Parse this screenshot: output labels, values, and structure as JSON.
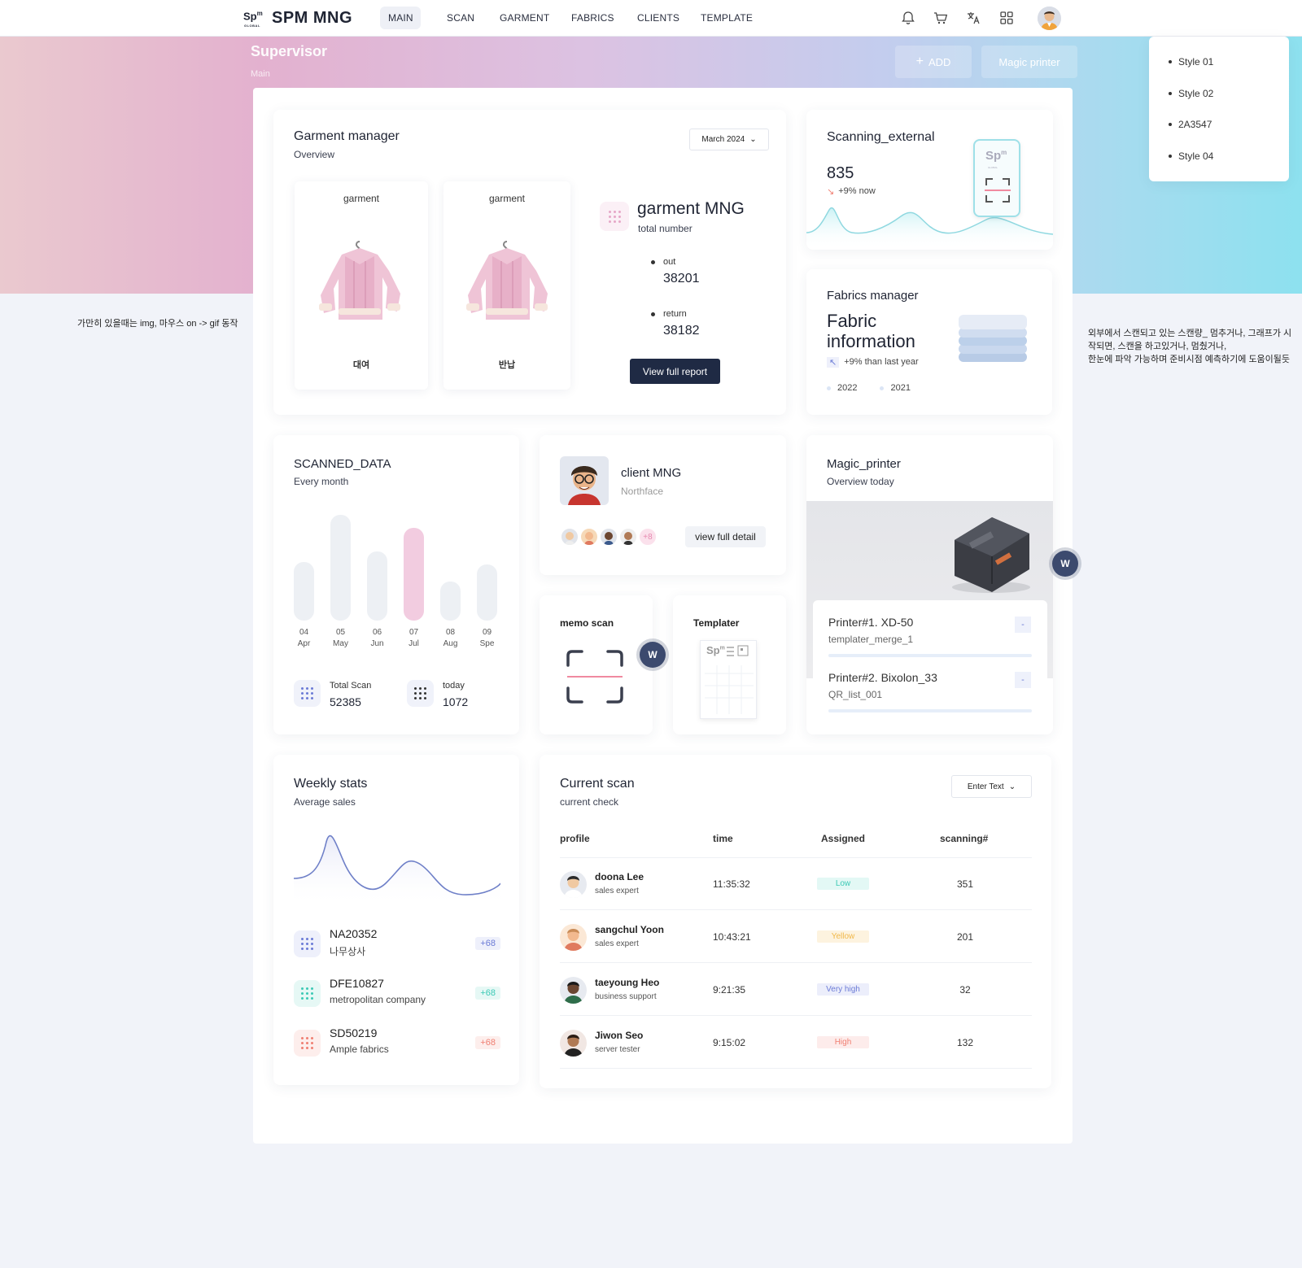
{
  "brand": {
    "mark": "Sp",
    "mark_sup": "m",
    "mark_small": "GLOBAL",
    "name": "SPM MNG"
  },
  "nav": {
    "items": [
      "MAIN",
      "SCAN",
      "GARMENT",
      "FABRICS",
      "CLIENTS",
      "TEMPLATE"
    ],
    "active": "MAIN"
  },
  "toolbar_icons": [
    "bell-icon",
    "cart-icon",
    "translate-icon",
    "apps-grid-icon"
  ],
  "hero": {
    "title": "Supervisor",
    "breadcrumb": "Main",
    "add_label": "ADD",
    "magic_label": "Magic printer"
  },
  "style_menu": [
    "Style 01",
    "Style 02",
    "2A3547",
    "Style 04"
  ],
  "notes": {
    "left": "가만히 있을때는 img, 마우스 on -> gif 동작",
    "right": [
      "외부에서 스캔되고 있는 스캔량_ 멈추거나, 그래프가 시",
      "작되면, 스캔을 하고있거나, 멈췄거나,",
      "한눈에 파악 가능하며 준비시점 예측하기에 도움이될듯"
    ]
  },
  "garment_manager": {
    "title": "Garment manager",
    "subtitle": "Overview",
    "month": "March 2024",
    "cards": [
      {
        "top": "garment",
        "bottom": "대여"
      },
      {
        "top": "garment",
        "bottom": "반납"
      }
    ],
    "mng_title": "garment MNG",
    "mng_sub": "total number",
    "out_label": "out",
    "out_value": "38201",
    "return_label": "return",
    "return_value": "38182",
    "report_button": "View full report"
  },
  "scanning_external": {
    "title": "Scanning_external",
    "value": "835",
    "trend": "+9% now",
    "phone_logo": "Sp",
    "phone_logo_sup": "m",
    "phone_logo_small": "GLOBAL"
  },
  "fabrics_manager": {
    "title": "Fabrics manager",
    "headline1": "Fabric",
    "headline2": "information",
    "trend": "+9% than last year",
    "legend": [
      "2022",
      "2021"
    ]
  },
  "scanned_data": {
    "title": "SCANNED_DATA",
    "subtitle": "Every month",
    "total_label": "Total Scan",
    "total_value": "52385",
    "today_label": "today",
    "today_value": "1072"
  },
  "chart_data": {
    "type": "bar",
    "categories": [
      "04 Apr",
      "05 May",
      "06 Jun",
      "07 Jul",
      "08 Aug",
      "09 Spe"
    ],
    "tick_top": [
      "04",
      "05",
      "06",
      "07",
      "08",
      "09"
    ],
    "tick_bottom": [
      "Apr",
      "May",
      "Jun",
      "Jul",
      "Aug",
      "Spe"
    ],
    "values": [
      55,
      100,
      65,
      88,
      37,
      53
    ],
    "highlight_index": 3,
    "bar_color": "#edf0f4",
    "highlight_color": "#f2cce0",
    "title": "SCANNED_DATA",
    "xlabel": "",
    "ylabel": ""
  },
  "client_mng": {
    "title": "client MNG",
    "subtitle": "Northface",
    "more_count": "+8",
    "button": "view full detail"
  },
  "memo_scan": {
    "title": "memo scan",
    "badge": "W"
  },
  "templater": {
    "title": "Templater",
    "logo": "Sp",
    "logo_sup": "m"
  },
  "magic_printer": {
    "title": "Magic_printer",
    "subtitle": "Overview today",
    "badge": "W",
    "printers": [
      {
        "name": "Printer#1. XD-50",
        "file": "templater_merge_1",
        "toggle": "-"
      },
      {
        "name": "Printer#2. Bixolon_33",
        "file": "QR_list_001",
        "toggle": "-"
      }
    ]
  },
  "weekly_stats": {
    "title": "Weekly stats",
    "subtitle": "Average sales",
    "items": [
      {
        "code": "NA20352",
        "name": "나무상사",
        "delta": "+68",
        "color": "#6b7bd6",
        "bg": "#eef0fb"
      },
      {
        "code": "DFE10827",
        "name": "metropolitan company",
        "delta": "+68",
        "color": "#3cc9b5",
        "bg": "#e6f8f5"
      },
      {
        "code": "SD50219",
        "name": "Ample fabrics",
        "delta": "+68",
        "color": "#f07f72",
        "bg": "#fdeeec"
      }
    ]
  },
  "current_scan": {
    "title": "Current scan",
    "subtitle": "current check",
    "filter": "Enter Text",
    "headers": [
      "profile",
      "time",
      "Assigned",
      "scanning#"
    ],
    "rows": [
      {
        "name": "doona Lee",
        "role": "sales expert",
        "time": "11:35:32",
        "assigned": "Low",
        "count": "351",
        "chip_color": "#3cc9b5",
        "chip_bg": "#e3f8f5"
      },
      {
        "name": "sangchul Yoon",
        "role": "sales expert",
        "time": "10:43:21",
        "assigned": "Yellow",
        "count": "201",
        "chip_color": "#f1b84a",
        "chip_bg": "#fdf3df"
      },
      {
        "name": "taeyoung Heo",
        "role": "business support",
        "time": "9:21:35",
        "assigned": "Very high",
        "count": "32",
        "chip_color": "#6b7bd6",
        "chip_bg": "#eceefb"
      },
      {
        "name": "Jiwon Seo",
        "role": "server tester",
        "time": "9:15:02",
        "assigned": "High",
        "count": "132",
        "chip_color": "#f07f72",
        "chip_bg": "#fdeceb"
      }
    ]
  }
}
